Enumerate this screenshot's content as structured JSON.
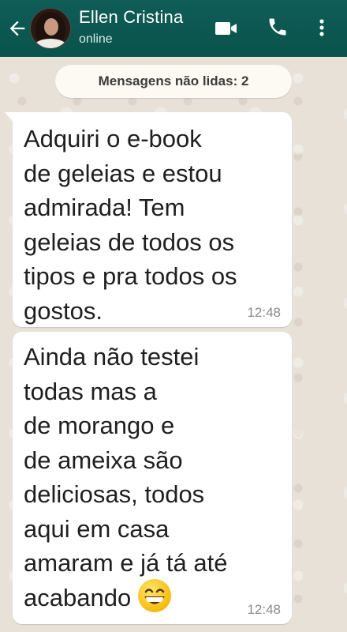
{
  "header": {
    "contact_name": "Ellen Cristina",
    "status": "online",
    "icons": [
      "back-arrow-icon",
      "avatar",
      "video-call-icon",
      "phone-icon",
      "more-vertical-icon"
    ]
  },
  "chat": {
    "unread_label": "Mensagens não lidas: 2",
    "messages": [
      {
        "text": "Adquiri o e-book\nde geleias e estou\nadmirada!  Tem\ngeleias de todos os\ntipos e pra todos os\ngostos.",
        "time": "12:48"
      },
      {
        "text": "Ainda não testei\ntodas mas a\nde morango e\nde ameixa são\ndeliciosas, todos\naqui em casa\namaram e já tá até\nacabando",
        "emoji": "grinning-smiling-eyes-emoji",
        "time": "12:48"
      }
    ]
  },
  "colors": {
    "header_bg": "#0a534d",
    "chat_bg": "#e7e1d8",
    "bubble_bg": "#ffffff",
    "time_text": "#8a8a8a"
  }
}
